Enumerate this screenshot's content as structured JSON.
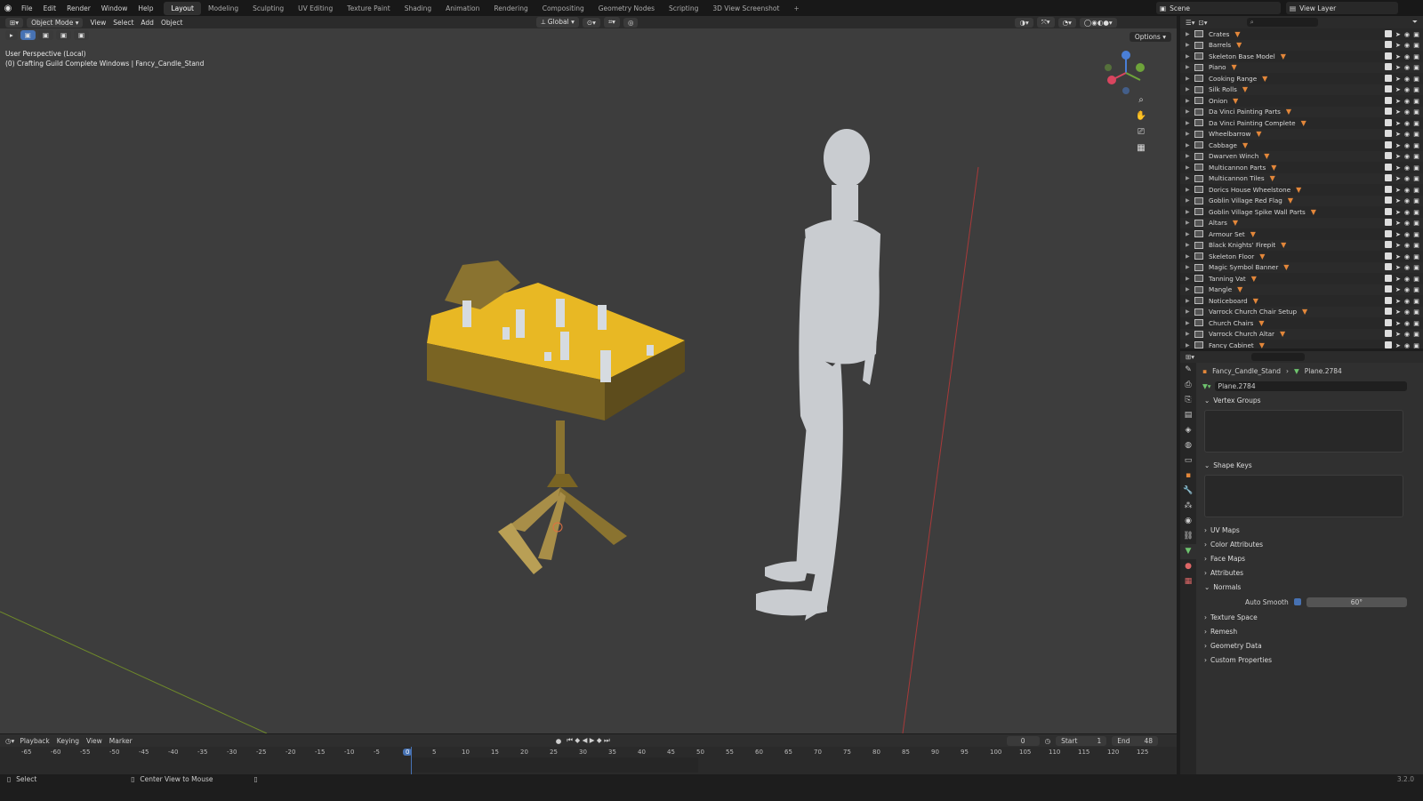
{
  "topbar": {
    "menus": [
      "File",
      "Edit",
      "Render",
      "Window",
      "Help"
    ],
    "workspaces": [
      "Layout",
      "Modeling",
      "Sculpting",
      "UV Editing",
      "Texture Paint",
      "Shading",
      "Animation",
      "Rendering",
      "Compositing",
      "Geometry Nodes",
      "Scripting",
      "3D View Screenshot"
    ],
    "active_workspace": "Layout",
    "scene": "Scene",
    "view_layer": "View Layer"
  },
  "viewport": {
    "mode": "Object Mode",
    "menus": [
      "View",
      "Select",
      "Add",
      "Object"
    ],
    "transform": "Global",
    "perspective_label": "User Perspective (Local)",
    "collection_path": "(0) Crafting Guild Complete Windows | Fancy_Candle_Stand",
    "options_label": "Options"
  },
  "outliner": {
    "items": [
      "Crates",
      "Barrels",
      "Skeleton Base Model",
      "Piano",
      "Cooking Range",
      "Silk Rolls",
      "Onion",
      "Da Vinci Painting Parts",
      "Da Vinci Painting Complete",
      "Wheelbarrow",
      "Cabbage",
      "Dwarven Winch",
      "Multicannon Parts",
      "Multicannon Tiles",
      "Dorics House Wheelstone",
      "Goblin Village Red Flag",
      "Goblin Village Spike Wall Parts",
      "Altars",
      "Armour Set",
      "Black Knights' Firepit",
      "Skeleton Floor",
      "Magic Symbol Banner",
      "Tanning Vat",
      "Mangle",
      "Noticeboard",
      "Varrock Church Chair Setup",
      "Church Chairs",
      "Varrock Church Altar",
      "Fancy Cabinet"
    ]
  },
  "properties": {
    "object": "Fancy_Candle_Stand",
    "mesh": "Plane.2784",
    "datablock": "Plane.2784",
    "sections": {
      "vertex_groups": "Vertex Groups",
      "shape_keys": "Shape Keys",
      "uv_maps": "UV Maps",
      "color_attributes": "Color Attributes",
      "face_maps": "Face Maps",
      "attributes": "Attributes",
      "normals": "Normals",
      "texture_space": "Texture Space",
      "remesh": "Remesh",
      "geometry_data": "Geometry Data",
      "custom_properties": "Custom Properties"
    },
    "auto_smooth_label": "Auto Smooth",
    "auto_smooth_angle": "60°"
  },
  "timeline": {
    "menus": [
      "Playback",
      "Keying",
      "View",
      "Marker"
    ],
    "current_frame": "0",
    "start_label": "Start",
    "start": "1",
    "end_label": "End",
    "end": "48",
    "ticks": [
      "-65",
      "-60",
      "-55",
      "-50",
      "-45",
      "-40",
      "-35",
      "-30",
      "-25",
      "-20",
      "-15",
      "-10",
      "-5",
      "0",
      "5",
      "10",
      "15",
      "20",
      "25",
      "30",
      "35",
      "40",
      "45",
      "50",
      "55",
      "60",
      "65",
      "70",
      "75",
      "80",
      "85",
      "90",
      "95",
      "100",
      "105",
      "110",
      "115",
      "120",
      "125"
    ]
  },
  "statusbar": {
    "select": "Select",
    "center": "Center View to Mouse",
    "version": "3.2.0"
  }
}
